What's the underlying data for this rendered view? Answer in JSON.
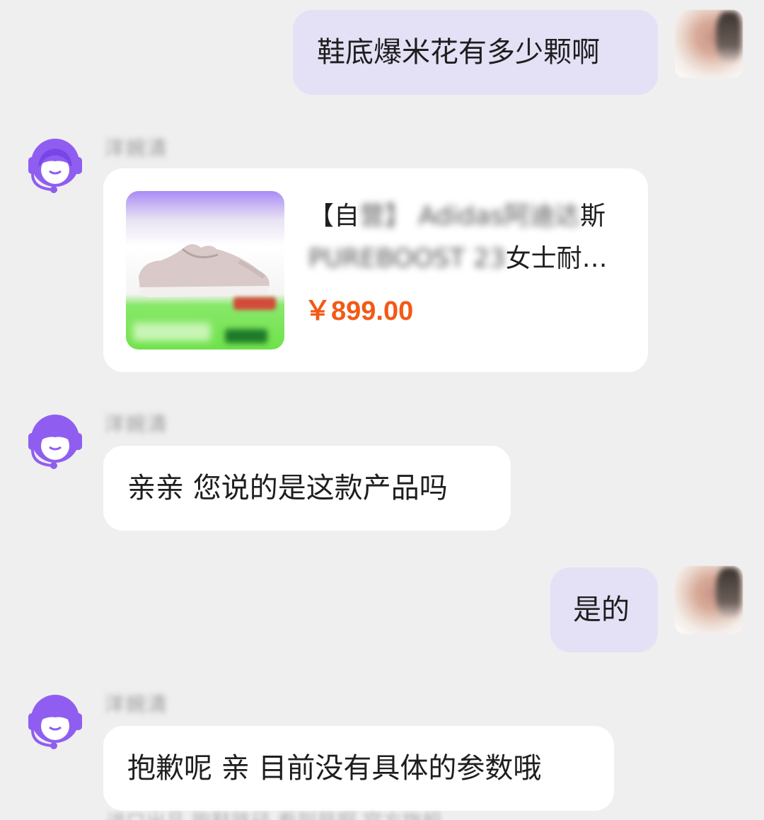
{
  "messages": {
    "m1": {
      "text": "鞋底爆米花有多少颗啊"
    },
    "m2": {
      "sender": "洋婉清",
      "product": {
        "title_visible_start": "【自",
        "title_blur_1": "营】 Adidas阿迪达",
        "title_visible_mid": "斯",
        "title_blur_2": "PUREBOOST 23",
        "title_visible_end": "女士耐…",
        "price": "￥899.00"
      }
    },
    "m3": {
      "sender": "洋婉清",
      "text": "亲亲 您说的是这款产品吗"
    },
    "m4": {
      "text": "是的"
    },
    "m5": {
      "sender": "洋婉清",
      "text": "抱歉呢 亲 目前没有具体的参数哦"
    },
    "m6_partial": {
      "text": "进口出品 跑鞋路径 看到是啊 官方旗舰"
    }
  },
  "colors": {
    "background": "#efeff0",
    "outgoing_bubble": "#e4e0f5",
    "incoming_bubble": "#ffffff",
    "agent_purple": "#8f5ef0",
    "price_orange": "#f25a16"
  },
  "icons": {
    "agent_avatar": "headset-agent-icon",
    "user_avatar": "user-avatar"
  }
}
